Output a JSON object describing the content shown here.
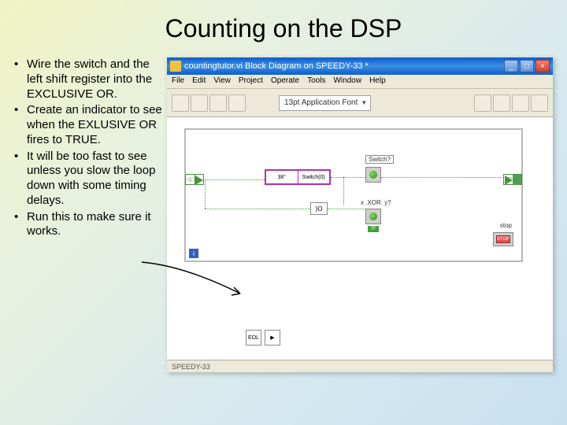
{
  "title": "Counting on the DSP",
  "bullets": [
    "Wire the switch and the left shift register into the EXCLUSIVE OR.",
    "Create an indicator to see when the EXLUSIVE OR fires to TRUE.",
    "It will be too fast to see unless you slow the loop down with some timing delays.",
    "Run this to make sure it works."
  ],
  "window": {
    "title": "countingtutor.vi Block Diagram on SPEEDY-33 *",
    "menu": [
      "File",
      "Edit",
      "View",
      "Project",
      "Operate",
      "Tools",
      "Window",
      "Help"
    ],
    "font_label": "13pt Application Font",
    "status": "SPEEDY-33"
  },
  "diagram": {
    "switch_left": "38°",
    "switch_right": "Switch(0)",
    "switch_label": "Switch?",
    "xor_label": ")O",
    "xor_out": "x .XOR. y?",
    "tf": "TF",
    "stop_label": "stop",
    "stop_text": "STOP",
    "loop_glyph": "i",
    "tunnel_left": "◁□",
    "node_b1": "EOL",
    "node_b2": "▶"
  }
}
